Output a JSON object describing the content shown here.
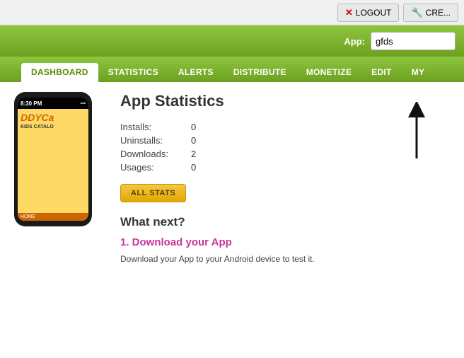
{
  "topbar": {
    "logout_label": "LOGOUT",
    "create_label": "CRE...",
    "logout_icon": "✕",
    "create_icon": "🔧"
  },
  "appbar": {
    "app_label": "App:",
    "app_value": "gfds"
  },
  "nav": {
    "tabs": [
      {
        "id": "dashboard",
        "label": "DASHBOARD",
        "active": true
      },
      {
        "id": "statistics",
        "label": "STATISTICS",
        "active": false
      },
      {
        "id": "alerts",
        "label": "ALERTS",
        "active": false
      },
      {
        "id": "distribute",
        "label": "DISTRIBUTE",
        "active": false
      },
      {
        "id": "monetize",
        "label": "MONETIZE",
        "active": false
      },
      {
        "id": "edit",
        "label": "EDIT",
        "active": false
      },
      {
        "id": "my",
        "label": "MY",
        "active": false
      }
    ]
  },
  "stats": {
    "title": "App Statistics",
    "rows": [
      {
        "label": "Installs:",
        "value": "0"
      },
      {
        "label": "Uninstalls:",
        "value": "0"
      },
      {
        "label": "Downloads:",
        "value": "2"
      },
      {
        "label": "Usages:",
        "value": "0"
      }
    ],
    "all_stats_button": "ALL STATS"
  },
  "phone": {
    "time": "8:30 PM",
    "app_title": "DDYCa",
    "app_subtitle": "KIDS CATALO",
    "bottom_label": "HOME"
  },
  "what_next": {
    "title": "What next?",
    "step1_label": "1. Download your App",
    "step1_desc": "Download your App to your Android device to test it."
  }
}
